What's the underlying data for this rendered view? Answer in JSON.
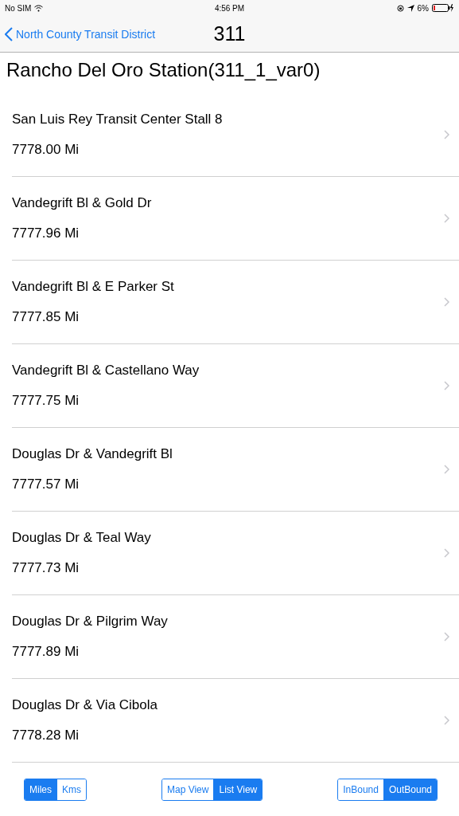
{
  "status_bar": {
    "carrier": "No SIM",
    "time": "4:56 PM",
    "battery": "6%"
  },
  "nav": {
    "back": "North County Transit District",
    "title": "311"
  },
  "heading": "Rancho Del Oro Station(311_1_var0)",
  "stops": [
    {
      "name": "San Luis Rey Transit Center Stall 8",
      "distance": "7778.00 Mi"
    },
    {
      "name": "Vandegrift Bl & Gold Dr",
      "distance": "7777.96 Mi"
    },
    {
      "name": "Vandegrift Bl & E Parker St",
      "distance": "7777.85 Mi"
    },
    {
      "name": "Vandegrift Bl & Castellano Way",
      "distance": "7777.75 Mi"
    },
    {
      "name": "Douglas Dr & Vandegrift Bl",
      "distance": "7777.57 Mi"
    },
    {
      "name": "Douglas Dr & Teal Way",
      "distance": "7777.73 Mi"
    },
    {
      "name": "Douglas Dr & Pilgrim Way",
      "distance": "7777.89 Mi"
    },
    {
      "name": "Douglas Dr & Via Cibola",
      "distance": "7778.28 Mi"
    }
  ],
  "toolbar": [
    [
      {
        "label": "Miles",
        "selected": true
      },
      {
        "label": "Kms",
        "selected": false
      }
    ],
    [
      {
        "label": "Map View",
        "selected": false
      },
      {
        "label": "List View",
        "selected": true
      }
    ],
    [
      {
        "label": "InBound",
        "selected": false
      },
      {
        "label": "OutBound",
        "selected": true
      }
    ]
  ]
}
